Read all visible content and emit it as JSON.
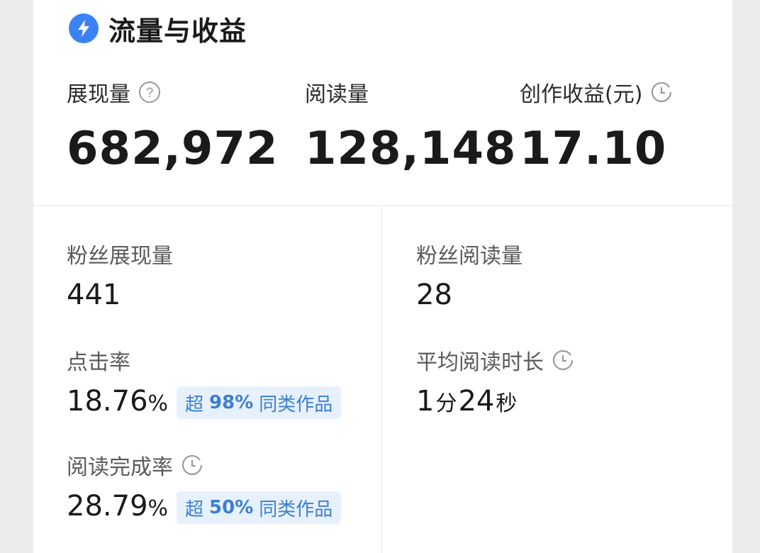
{
  "header": {
    "title": "流量与收益",
    "icon": "lightning-bolt-icon",
    "accent": "#3b82f6"
  },
  "top_metrics": {
    "impressions": {
      "label": "展现量",
      "value": "682,972",
      "icon": "help-circle-icon"
    },
    "reads": {
      "label": "阅读量",
      "value": "128,148"
    },
    "earnings": {
      "label": "创作收益(元)",
      "value": "17.10",
      "icon": "clock-icon"
    }
  },
  "fan_impressions": {
    "label": "粉丝展现量",
    "value": "441"
  },
  "fan_reads": {
    "label": "粉丝阅读量",
    "value": "28"
  },
  "ctr": {
    "label": "点击率",
    "value": "18.76",
    "unit": "%",
    "badge": {
      "prefix": "超",
      "percent": "98%",
      "suffix": "同类作品"
    }
  },
  "avg_read_time": {
    "label": "平均阅读时长",
    "icon": "clock-icon",
    "minutes": "1",
    "minutes_unit": "分",
    "seconds": "24",
    "seconds_unit": "秒"
  },
  "completion_rate": {
    "label": "阅读完成率",
    "icon": "clock-icon",
    "value": "28.79",
    "unit": "%",
    "badge": {
      "prefix": "超",
      "percent": "50%",
      "suffix": "同类作品"
    }
  }
}
